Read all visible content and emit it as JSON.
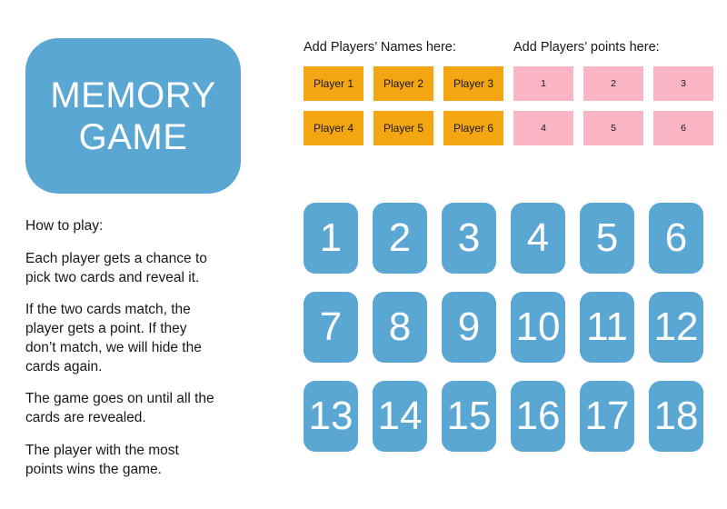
{
  "theme": {
    "background": "#ffffff",
    "blue": "#5BA7D4",
    "orange": "#F4A512",
    "pink": "#FAB5C5",
    "text": "#17181a",
    "card_text": "#ffffff"
  },
  "title": {
    "text": "MEMORY\nGAME"
  },
  "instructions": {
    "heading": "How to play:",
    "paragraphs": [
      "How to play:",
      "Each player gets a chance to\npick two cards and reveal it.",
      "If the two cards match, the\nplayer gets a point. If they\ndon’t match, we will hide the\ncards again.",
      "The game goes on until all the\ncards are revealed.",
      "The player with the most\npoints wins the game."
    ]
  },
  "names_section": {
    "header": "Add Players’ Names here:",
    "boxes": [
      {
        "label": "Player 1"
      },
      {
        "label": "Player 2"
      },
      {
        "label": "Player 3"
      },
      {
        "label": "Player 4"
      },
      {
        "label": "Player 5"
      },
      {
        "label": "Player 6"
      }
    ]
  },
  "points_section": {
    "header": "Add Players’ points here:",
    "boxes": [
      {
        "label": "1"
      },
      {
        "label": "2"
      },
      {
        "label": "3"
      },
      {
        "label": "4"
      },
      {
        "label": "5"
      },
      {
        "label": "6"
      }
    ]
  },
  "card_grid": {
    "columns": 6,
    "rows": 3,
    "cards": [
      {
        "label": "1"
      },
      {
        "label": "2"
      },
      {
        "label": "3"
      },
      {
        "label": "4"
      },
      {
        "label": "5"
      },
      {
        "label": "6"
      },
      {
        "label": "7"
      },
      {
        "label": "8"
      },
      {
        "label": "9"
      },
      {
        "label": "10"
      },
      {
        "label": "11"
      },
      {
        "label": "12"
      },
      {
        "label": "13"
      },
      {
        "label": "14"
      },
      {
        "label": "15"
      },
      {
        "label": "16"
      },
      {
        "label": "17"
      },
      {
        "label": "18"
      }
    ]
  }
}
